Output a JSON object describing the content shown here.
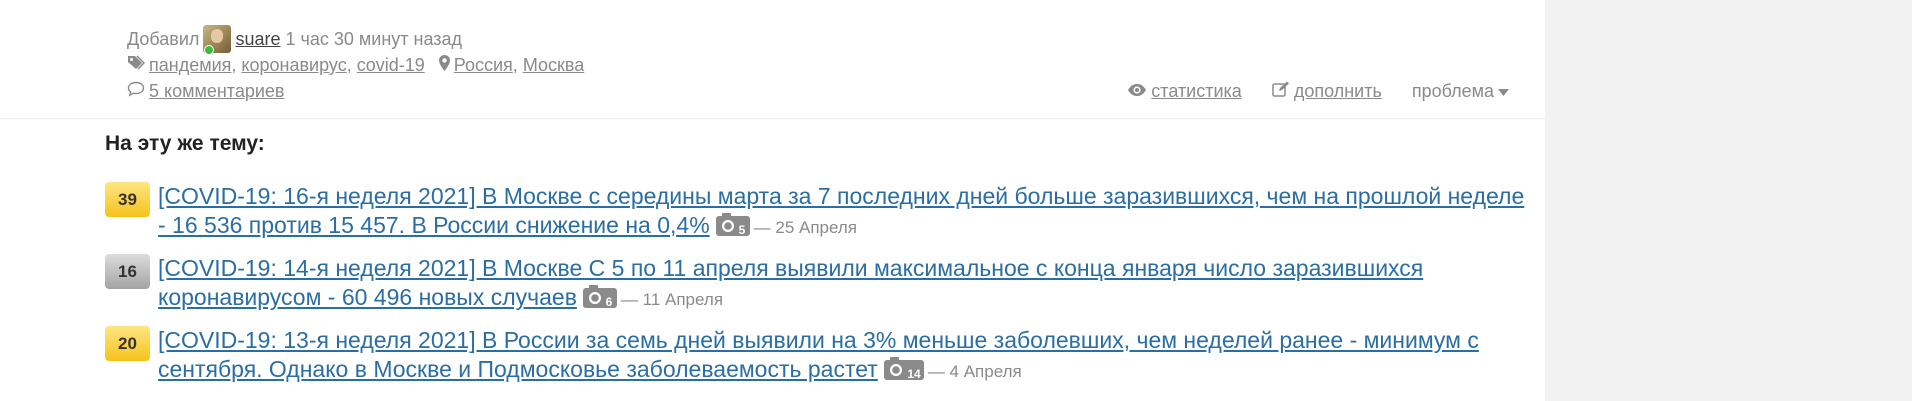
{
  "meta": {
    "added_label": "Добавил",
    "author": "suare",
    "time_ago": "1 час 30 минут назад",
    "tags": [
      "пандемия",
      "коронавирус",
      "covid-19"
    ],
    "places": [
      "Россия",
      "Москва"
    ],
    "comments": "5 комментариев"
  },
  "actions": {
    "stats": "статистика",
    "edit": "дополнить",
    "problem": "проблема"
  },
  "related": {
    "title": "На эту же тему:",
    "items": [
      {
        "score": "39",
        "score_color": "gold",
        "text": "[COVID-19: 16-я неделя 2021] В Москве с середины марта за 7 последних дней больше заразившихся, чем на прошлой неделе - 16 536 против 15 457. В России снижение на 0,4%",
        "photos": "5",
        "date": "— 25 Апреля"
      },
      {
        "score": "16",
        "score_color": "gray",
        "text": "[COVID-19: 14-я неделя 2021] В Москве С 5 по 11 апреля выявили максимальное с конца января число заразившихся коронавирусом - 60 496 новых случаев",
        "photos": "6",
        "date": "— 11 Апреля"
      },
      {
        "score": "20",
        "score_color": "gold",
        "text": "[COVID-19: 13-я неделя 2021] В России за семь дней выявили на 3% меньше заболевших, чем неделей ранее - минимум с сентября. Однако в Москве и Подмосковье заболеваемость растет",
        "photos": "14",
        "date": "— 4 Апреля"
      }
    ]
  },
  "colors": {
    "link": "#2a6ea3",
    "muted": "#8a8a8a",
    "badge_gold": "#f5c31c",
    "badge_gray": "#a4a4a4",
    "online": "#3dbb3d"
  }
}
